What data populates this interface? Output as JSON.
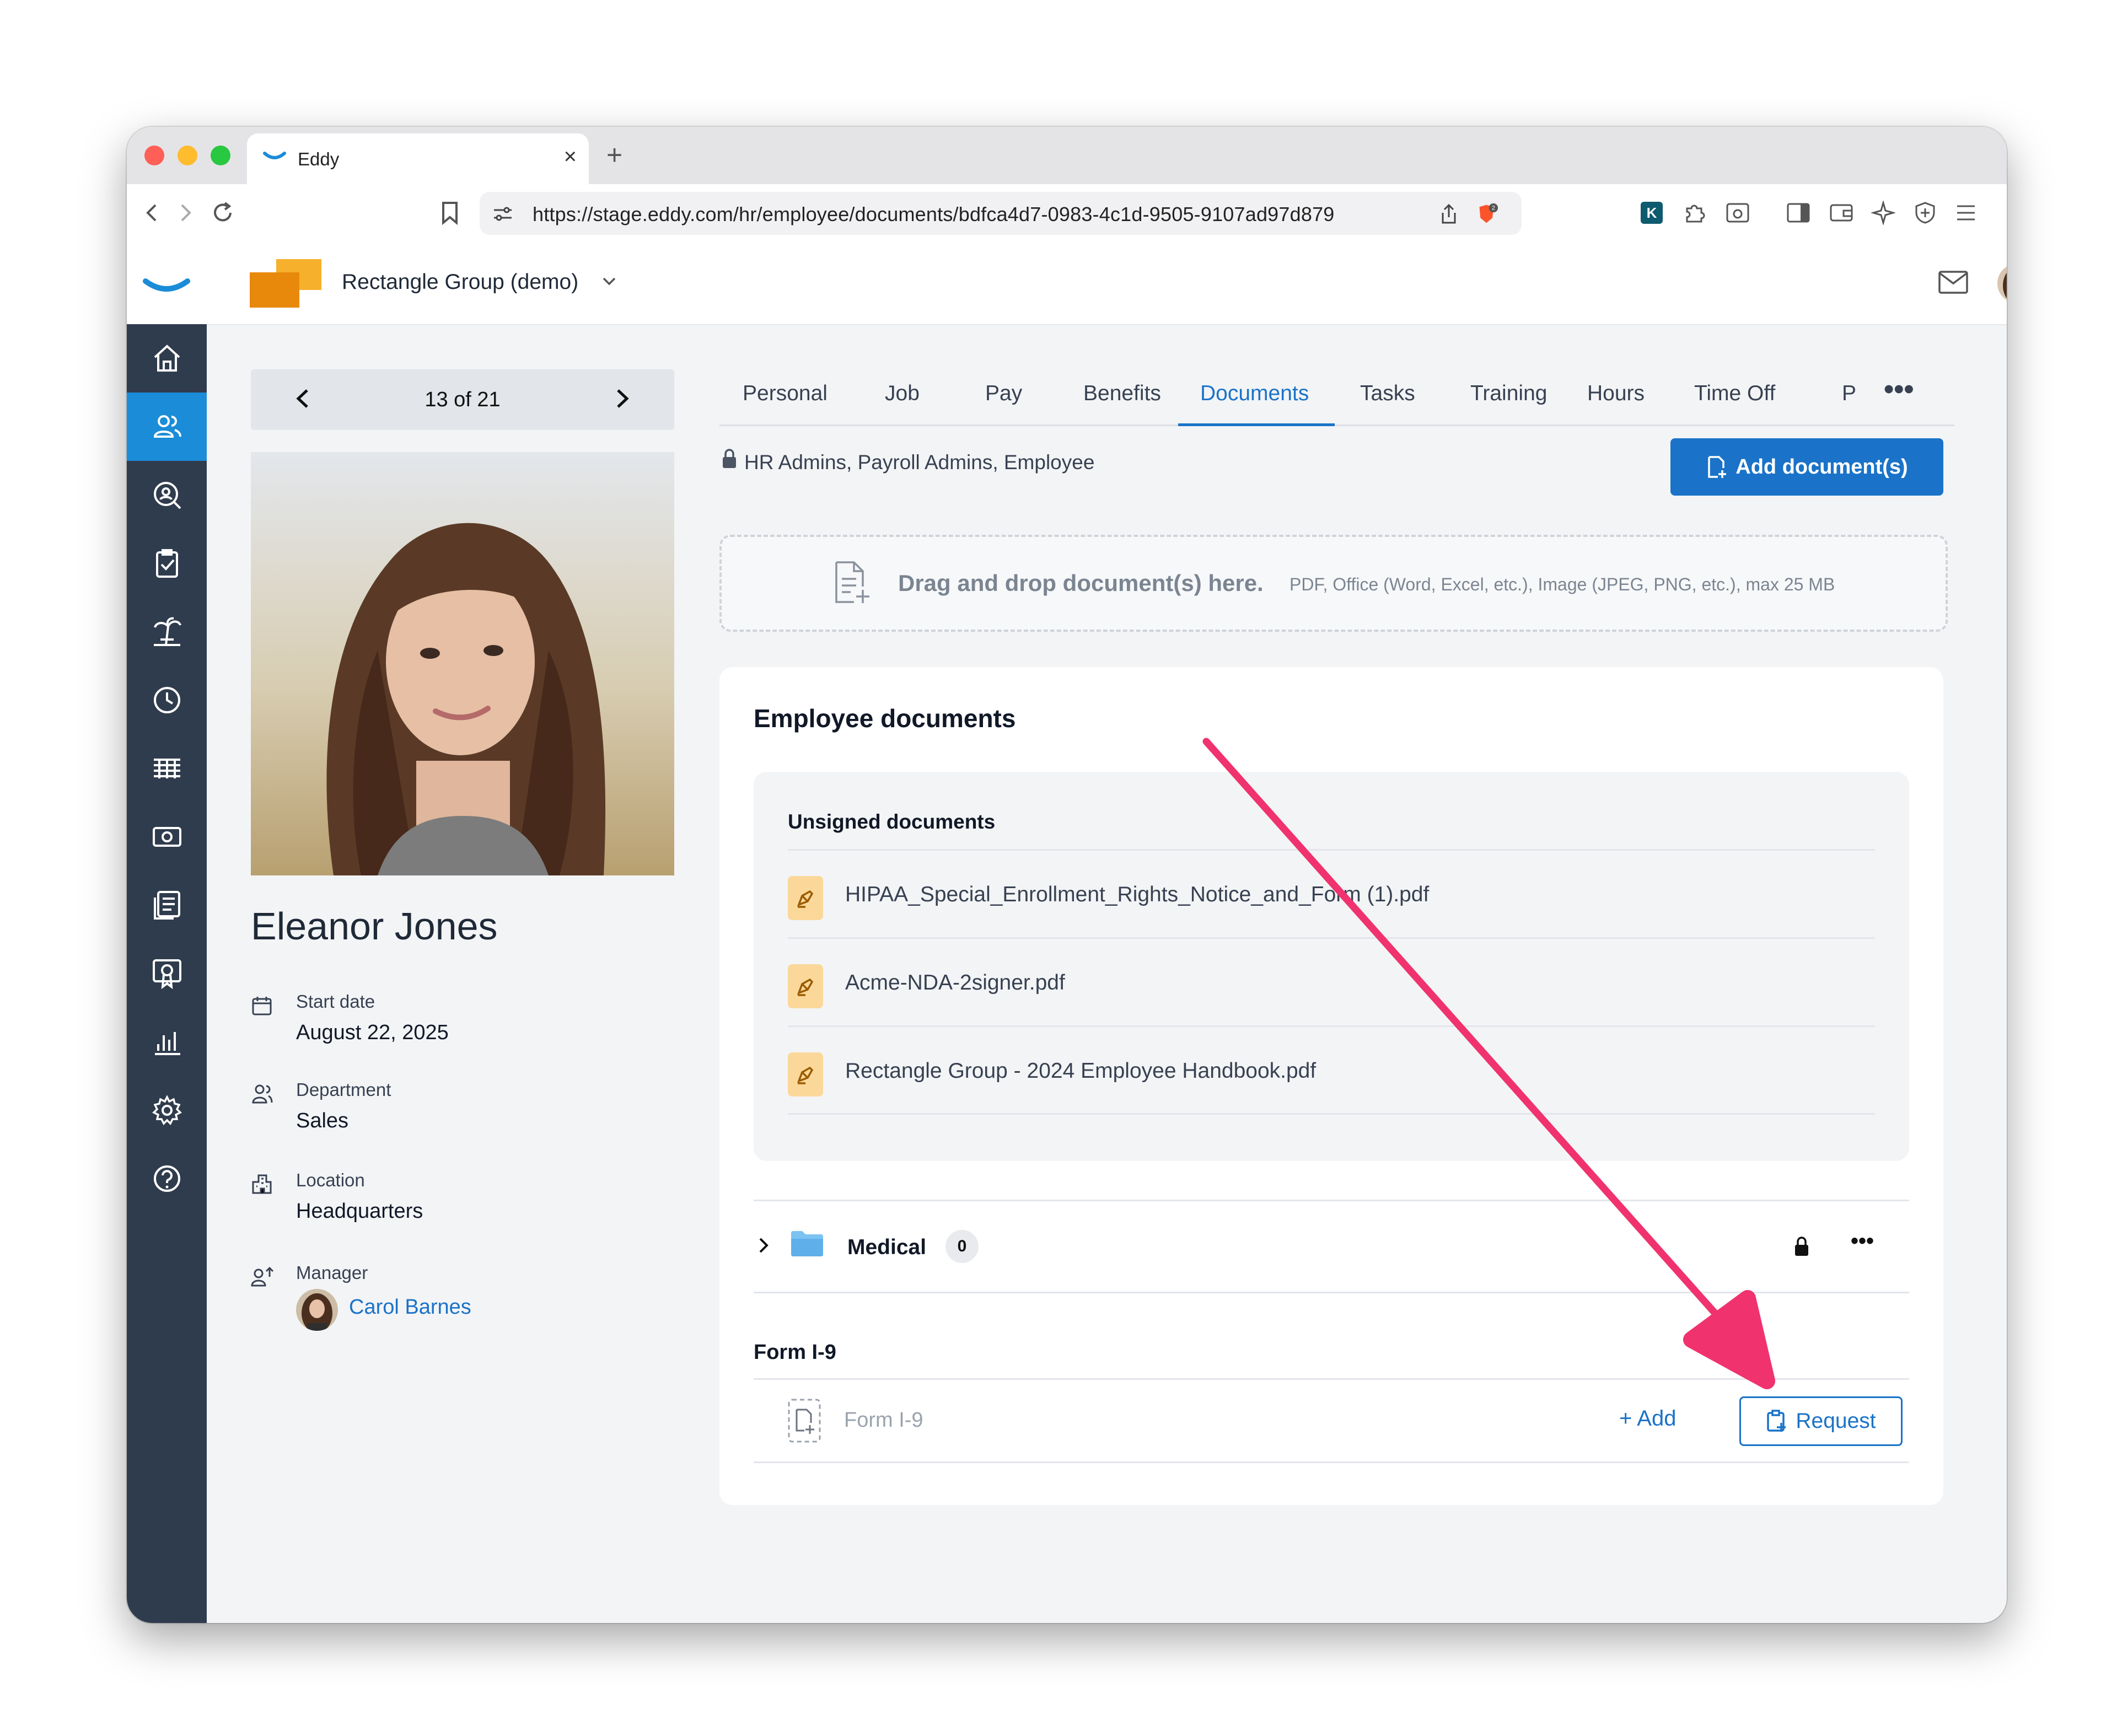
{
  "browser": {
    "tab_title": "Eddy",
    "url": "https://stage.eddy.com/hr/employee/documents/bdfca4d7-0983-4c1d-9505-9107ad97d879",
    "shield_badge": "2"
  },
  "header": {
    "company_name": "Rectangle Group (demo)"
  },
  "profile": {
    "pager": "13 of 21",
    "name": "Eleanor Jones",
    "fields": {
      "start_date": {
        "label": "Start date",
        "value": "August 22, 2025"
      },
      "department": {
        "label": "Department",
        "value": "Sales"
      },
      "location": {
        "label": "Location",
        "value": "Headquarters"
      },
      "manager": {
        "label": "Manager",
        "value": "Carol Barnes"
      }
    }
  },
  "tabs": [
    "Personal",
    "Job",
    "Pay",
    "Benefits",
    "Documents",
    "Tasks",
    "Training",
    "Hours",
    "Time Off",
    "P"
  ],
  "active_tab": "Documents",
  "permissions": "HR Admins, Payroll Admins, Employee",
  "add_document_label": "Add document(s)",
  "dropzone": {
    "title": "Drag and drop document(s) here.",
    "subtitle": "PDF, Office (Word, Excel, etc.), Image (JPEG, PNG, etc.), max 25 MB"
  },
  "documents": {
    "title": "Employee documents",
    "unsigned_title": "Unsigned documents",
    "unsigned": [
      "HIPAA_Special_Enrollment_Rights_Notice_and_Form (1).pdf",
      "Acme-NDA-2signer.pdf",
      "Rectangle Group - 2024 Employee Handbook.pdf"
    ],
    "folder": {
      "name": "Medical",
      "count": "0"
    },
    "i9": {
      "section_title": "Form I-9",
      "row_label": "Form I-9",
      "add_label": "Add",
      "request_label": "Request"
    }
  },
  "colors": {
    "accent": "#1a73c8",
    "sidebar": "#2f3c4d",
    "sidebar_active": "#1a8cd8",
    "annotation_arrow": "#f0326e",
    "company_logo": "#f0a020"
  }
}
